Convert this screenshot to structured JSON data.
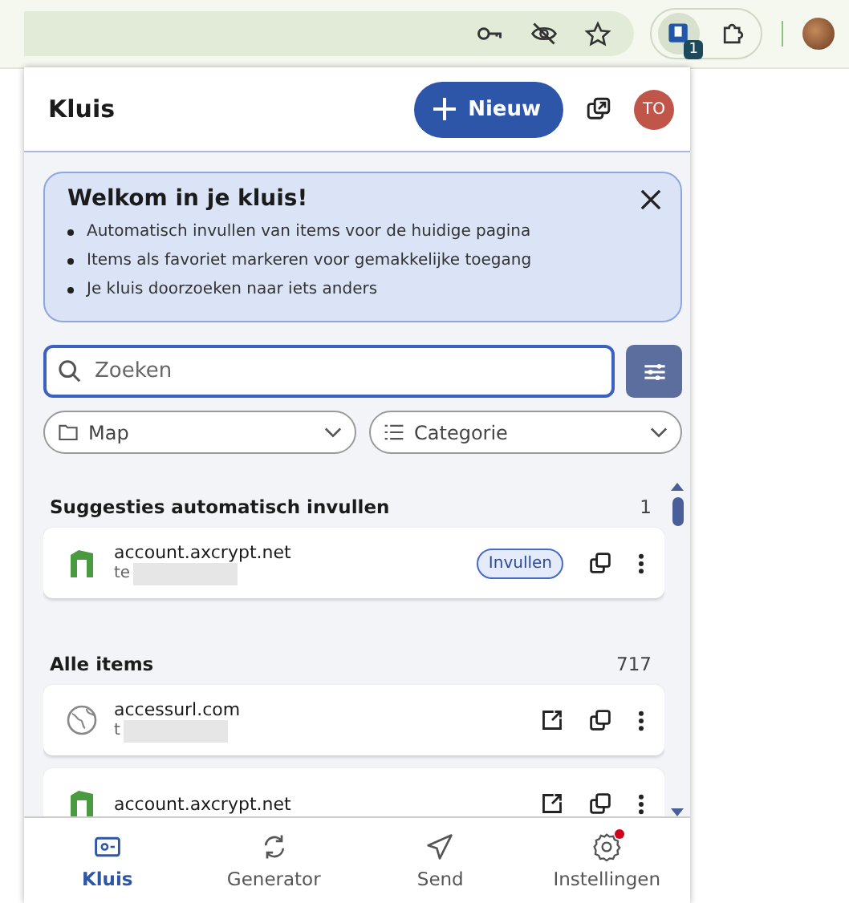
{
  "browser": {
    "extension_badge": "1"
  },
  "header": {
    "title": "Kluis",
    "new_button": "Nieuw",
    "avatar": "TO"
  },
  "welcome": {
    "title": "Welkom in je kluis!",
    "bullets": [
      "Automatisch invullen van items voor de huidige pagina",
      "Items als favoriet markeren voor gemakkelijke toegang",
      "Je kluis doorzoeken naar iets anders"
    ]
  },
  "search": {
    "placeholder": "Zoeken"
  },
  "filters": [
    {
      "kind": "folder",
      "label": "Map"
    },
    {
      "kind": "list",
      "label": "Categorie"
    }
  ],
  "sections": [
    {
      "title": "Suggesties automatisch invullen",
      "count": "1",
      "items": [
        {
          "kind": "login",
          "name": "account.axcrypt.net",
          "username": "te",
          "fill_button": "Invullen"
        }
      ]
    },
    {
      "title": "Alle items",
      "count": "717",
      "items": [
        {
          "kind": "globe",
          "name": "accessurl.com",
          "username": "t"
        },
        {
          "kind": "login",
          "name": "account.axcrypt.net"
        }
      ]
    }
  ],
  "nav": [
    {
      "kind": "vault",
      "label": "Kluis",
      "selected": true,
      "badge": false
    },
    {
      "kind": "generator",
      "label": "Generator",
      "selected": false,
      "badge": false
    },
    {
      "kind": "send",
      "label": "Send",
      "selected": false,
      "badge": false
    },
    {
      "kind": "settings",
      "label": "Instellingen",
      "selected": false,
      "badge": true
    }
  ]
}
